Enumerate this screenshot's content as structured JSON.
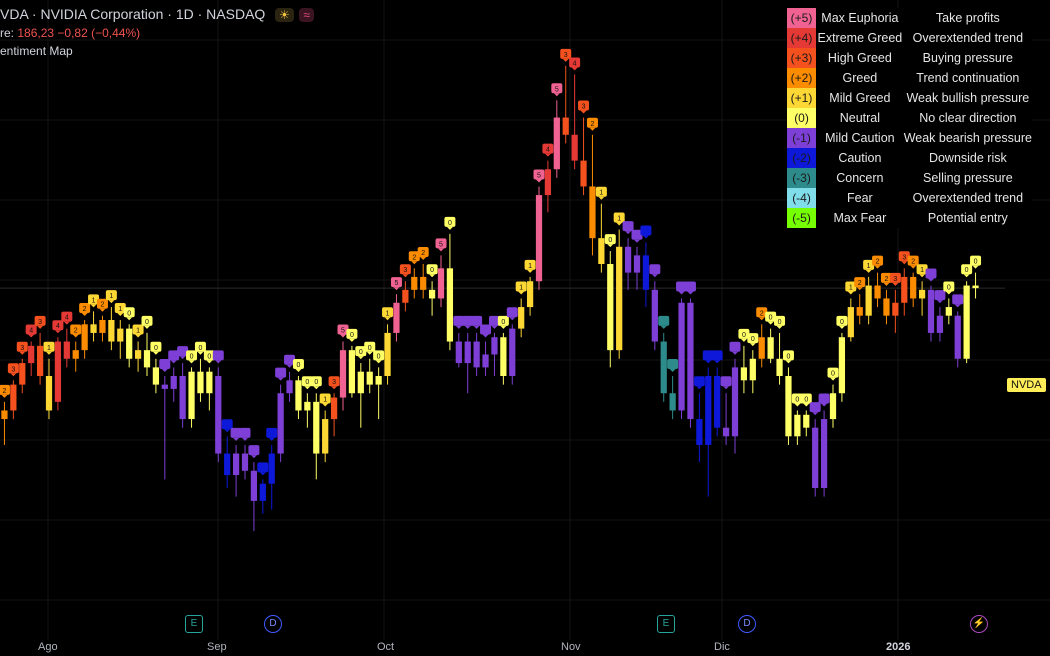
{
  "header": {
    "title": "VDA · NVIDIA Corporation · 1D · NASDAQ",
    "badge1": "☀",
    "badge2": "≈",
    "close_label": "re:",
    "close_value": "186,23",
    "change": "−0,82 (−0,44%)",
    "indicator": "entiment Map"
  },
  "legend": [
    {
      "code": "(+5)",
      "label": "Max Euphoria",
      "desc": "Take profits",
      "color": "#f06292"
    },
    {
      "code": "(+4)",
      "label": "Extreme Greed",
      "desc": "Overextended trend",
      "color": "#e53935"
    },
    {
      "code": "(+3)",
      "label": "High Greed",
      "desc": "Buying pressure",
      "color": "#f4511e"
    },
    {
      "code": "(+2)",
      "label": "Greed",
      "desc": "Trend continuation",
      "color": "#fb8c00"
    },
    {
      "code": "(+1)",
      "label": "Mild Greed",
      "desc": "Weak bullish pressure",
      "color": "#fdd835"
    },
    {
      "code": "(0)",
      "label": "Neutral",
      "desc": "No clear direction",
      "color": "#ffff66"
    },
    {
      "code": "(-1)",
      "label": "Mild Caution",
      "desc": "Weak bearish pressure",
      "color": "#7e3fd6"
    },
    {
      "code": "(-2)",
      "label": "Caution",
      "desc": "Downside risk",
      "color": "#0d18d8"
    },
    {
      "code": "(-3)",
      "label": "Concern",
      "desc": "Selling pressure",
      "color": "#2e8b8b"
    },
    {
      "code": "(-4)",
      "label": "Fear",
      "desc": "Overextended trend",
      "color": "#80deea"
    },
    {
      "code": "(-5)",
      "label": "Max Fear",
      "desc": "Potential entry",
      "color": "#76ff03"
    }
  ],
  "symbol_tag": "NVDA",
  "x_axis": {
    "labels": [
      "Ago",
      "Sep",
      "Oct",
      "Nov",
      "Dic",
      "2026"
    ],
    "bold": "2026"
  },
  "events": [
    {
      "type": "e",
      "glyph": "E"
    },
    {
      "type": "d",
      "glyph": "D"
    },
    {
      "type": "e",
      "glyph": "E"
    },
    {
      "type": "d",
      "glyph": "D"
    },
    {
      "type": "s",
      "glyph": "⚡"
    }
  ],
  "chart_data": {
    "type": "candlestick",
    "title": "NVIDIA Corporation · 1D · NASDAQ",
    "xlabel": "",
    "ylabel": "",
    "y_range_approx": [
      150,
      215
    ],
    "sentiment_scale": {
      "min": -5,
      "max": 5
    },
    "series": [
      {
        "name": "NVDA",
        "candles": [
          {
            "o": 171.0,
            "h": 173.0,
            "l": 168.0,
            "c": 172.0,
            "s": 2
          },
          {
            "o": 172.0,
            "h": 175.5,
            "l": 171.0,
            "c": 175.0,
            "s": 3
          },
          {
            "o": 175.0,
            "h": 178.0,
            "l": 174.0,
            "c": 177.5,
            "s": 3
          },
          {
            "o": 177.5,
            "h": 180.0,
            "l": 176.0,
            "c": 179.5,
            "s": 4
          },
          {
            "o": 179.5,
            "h": 181.0,
            "l": 175.0,
            "c": 176.0,
            "s": 3
          },
          {
            "o": 176.0,
            "h": 178.0,
            "l": 171.0,
            "c": 172.0,
            "s": 1
          },
          {
            "o": 173.0,
            "h": 180.5,
            "l": 172.0,
            "c": 180.0,
            "s": 4
          },
          {
            "o": 180.0,
            "h": 181.5,
            "l": 177.0,
            "c": 178.0,
            "s": 4
          },
          {
            "o": 178.0,
            "h": 180.0,
            "l": 176.5,
            "c": 179.0,
            "s": 2
          },
          {
            "o": 179.0,
            "h": 182.5,
            "l": 178.0,
            "c": 182.0,
            "s": 2
          },
          {
            "o": 182.0,
            "h": 183.5,
            "l": 180.0,
            "c": 181.0,
            "s": 1
          },
          {
            "o": 181.0,
            "h": 183.0,
            "l": 180.0,
            "c": 182.5,
            "s": 2
          },
          {
            "o": 182.5,
            "h": 184.0,
            "l": 179.0,
            "c": 180.0,
            "s": 1
          },
          {
            "o": 180.0,
            "h": 182.5,
            "l": 178.0,
            "c": 181.5,
            "s": 1
          },
          {
            "o": 181.5,
            "h": 182.0,
            "l": 177.0,
            "c": 178.0,
            "s": 0
          },
          {
            "o": 178.0,
            "h": 180.0,
            "l": 176.5,
            "c": 179.0,
            "s": 1
          },
          {
            "o": 179.0,
            "h": 181.0,
            "l": 176.0,
            "c": 177.0,
            "s": 0
          },
          {
            "o": 177.0,
            "h": 178.0,
            "l": 174.0,
            "c": 175.0,
            "s": 0
          },
          {
            "o": 175.0,
            "h": 176.0,
            "l": 164.0,
            "c": 174.5,
            "s": -1
          },
          {
            "o": 174.5,
            "h": 177.0,
            "l": 173.0,
            "c": 176.0,
            "s": -1
          },
          {
            "o": 176.0,
            "h": 177.5,
            "l": 170.0,
            "c": 171.0,
            "s": -1
          },
          {
            "o": 171.0,
            "h": 177.0,
            "l": 170.0,
            "c": 176.5,
            "s": 0
          },
          {
            "o": 176.5,
            "h": 178.0,
            "l": 173.0,
            "c": 174.0,
            "s": 0
          },
          {
            "o": 174.0,
            "h": 177.0,
            "l": 172.0,
            "c": 176.5,
            "s": 0
          },
          {
            "o": 176.0,
            "h": 177.0,
            "l": 166.0,
            "c": 167.0,
            "s": -1
          },
          {
            "o": 167.0,
            "h": 169.0,
            "l": 163.0,
            "c": 164.5,
            "s": -2
          },
          {
            "o": 164.5,
            "h": 168.0,
            "l": 162.0,
            "c": 167.0,
            "s": -1
          },
          {
            "o": 167.0,
            "h": 168.0,
            "l": 164.0,
            "c": 165.0,
            "s": -1
          },
          {
            "o": 165.0,
            "h": 166.0,
            "l": 158.0,
            "c": 161.5,
            "s": -1
          },
          {
            "o": 161.5,
            "h": 164.0,
            "l": 160.0,
            "c": 163.5,
            "s": -2
          },
          {
            "o": 163.5,
            "h": 168.0,
            "l": 160.5,
            "c": 167.0,
            "s": -2
          },
          {
            "o": 167.0,
            "h": 175.0,
            "l": 166.0,
            "c": 174.0,
            "s": -1
          },
          {
            "o": 174.0,
            "h": 176.5,
            "l": 173.0,
            "c": 175.5,
            "s": -1
          },
          {
            "o": 175.5,
            "h": 176.0,
            "l": 171.0,
            "c": 172.0,
            "s": 0
          },
          {
            "o": 172.0,
            "h": 174.0,
            "l": 170.0,
            "c": 173.0,
            "s": 0
          },
          {
            "o": 173.0,
            "h": 174.0,
            "l": 164.0,
            "c": 167.0,
            "s": 0
          },
          {
            "o": 167.0,
            "h": 172.0,
            "l": 166.0,
            "c": 171.0,
            "s": 1
          },
          {
            "o": 171.0,
            "h": 174.0,
            "l": 169.0,
            "c": 173.5,
            "s": 3
          },
          {
            "o": 173.5,
            "h": 180.0,
            "l": 172.0,
            "c": 179.0,
            "s": 5
          },
          {
            "o": 179.0,
            "h": 179.5,
            "l": 173.5,
            "c": 174.0,
            "s": 0
          },
          {
            "o": 174.0,
            "h": 177.5,
            "l": 170.0,
            "c": 176.5,
            "s": 0
          },
          {
            "o": 176.5,
            "h": 178.0,
            "l": 174.0,
            "c": 175.0,
            "s": 0
          },
          {
            "o": 175.0,
            "h": 177.0,
            "l": 171.0,
            "c": 176.0,
            "s": 0
          },
          {
            "o": 176.0,
            "h": 182.0,
            "l": 175.0,
            "c": 181.0,
            "s": 1
          },
          {
            "o": 181.0,
            "h": 185.5,
            "l": 180.0,
            "c": 184.5,
            "s": 5
          },
          {
            "o": 184.5,
            "h": 187.0,
            "l": 183.5,
            "c": 186.0,
            "s": 3
          },
          {
            "o": 186.0,
            "h": 188.5,
            "l": 185.0,
            "c": 187.5,
            "s": 2
          },
          {
            "o": 187.5,
            "h": 189.0,
            "l": 185.0,
            "c": 186.0,
            "s": 2
          },
          {
            "o": 186.0,
            "h": 187.0,
            "l": 183.0,
            "c": 185.0,
            "s": 0
          },
          {
            "o": 185.0,
            "h": 190.0,
            "l": 184.0,
            "c": 188.5,
            "s": 5
          },
          {
            "o": 188.5,
            "h": 192.5,
            "l": 179.0,
            "c": 180.0,
            "s": 0
          },
          {
            "o": 180.0,
            "h": 181.0,
            "l": 177.0,
            "c": 177.5,
            "s": -1
          },
          {
            "o": 177.5,
            "h": 181.0,
            "l": 174.0,
            "c": 180.0,
            "s": -1
          },
          {
            "o": 180.0,
            "h": 181.0,
            "l": 176.0,
            "c": 177.0,
            "s": -1
          },
          {
            "o": 177.0,
            "h": 180.0,
            "l": 176.0,
            "c": 178.5,
            "s": -1
          },
          {
            "o": 178.5,
            "h": 181.0,
            "l": 176.0,
            "c": 180.5,
            "s": -1
          },
          {
            "o": 180.5,
            "h": 181.0,
            "l": 175.0,
            "c": 176.0,
            "s": 0
          },
          {
            "o": 176.0,
            "h": 182.0,
            "l": 175.0,
            "c": 181.5,
            "s": -1
          },
          {
            "o": 181.5,
            "h": 185.0,
            "l": 180.5,
            "c": 184.0,
            "s": 1
          },
          {
            "o": 184.0,
            "h": 187.5,
            "l": 183.0,
            "c": 187.0,
            "s": 1
          },
          {
            "o": 187.0,
            "h": 198.0,
            "l": 186.0,
            "c": 197.0,
            "s": 5
          },
          {
            "o": 197.0,
            "h": 201.0,
            "l": 195.0,
            "c": 200.0,
            "s": 4
          },
          {
            "o": 200.0,
            "h": 208.0,
            "l": 199.0,
            "c": 206.0,
            "s": 5
          },
          {
            "o": 206.0,
            "h": 212.0,
            "l": 203.0,
            "c": 204.0,
            "s": 3
          },
          {
            "o": 204.0,
            "h": 211.0,
            "l": 200.0,
            "c": 201.0,
            "s": 4
          },
          {
            "o": 201.0,
            "h": 206.0,
            "l": 197.0,
            "c": 198.0,
            "s": 3
          },
          {
            "o": 198.0,
            "h": 204.0,
            "l": 190.0,
            "c": 192.0,
            "s": 2
          },
          {
            "o": 192.0,
            "h": 196.0,
            "l": 188.0,
            "c": 189.0,
            "s": 1
          },
          {
            "o": 189.0,
            "h": 190.5,
            "l": 177.0,
            "c": 179.0,
            "s": 0
          },
          {
            "o": 179.0,
            "h": 193.0,
            "l": 178.0,
            "c": 191.0,
            "s": 1
          },
          {
            "o": 191.0,
            "h": 192.0,
            "l": 186.0,
            "c": 188.0,
            "s": -1
          },
          {
            "o": 188.0,
            "h": 191.0,
            "l": 186.0,
            "c": 190.0,
            "s": -1
          },
          {
            "o": 190.0,
            "h": 191.5,
            "l": 184.0,
            "c": 186.0,
            "s": -2
          },
          {
            "o": 186.0,
            "h": 187.0,
            "l": 179.0,
            "c": 180.0,
            "s": -1
          },
          {
            "o": 180.0,
            "h": 181.0,
            "l": 173.0,
            "c": 174.0,
            "s": -3
          },
          {
            "o": 174.0,
            "h": 176.0,
            "l": 171.0,
            "c": 172.0,
            "s": -3
          },
          {
            "o": 172.0,
            "h": 185.0,
            "l": 171.0,
            "c": 184.5,
            "s": -1
          },
          {
            "o": 184.5,
            "h": 185.0,
            "l": 170.0,
            "c": 171.0,
            "s": -1
          },
          {
            "o": 171.0,
            "h": 174.0,
            "l": 166.0,
            "c": 168.0,
            "s": -2
          },
          {
            "o": 168.0,
            "h": 177.0,
            "l": 162.0,
            "c": 176.0,
            "s": -2
          },
          {
            "o": 176.0,
            "h": 177.0,
            "l": 169.0,
            "c": 170.0,
            "s": -2
          },
          {
            "o": 170.0,
            "h": 174.0,
            "l": 168.0,
            "c": 169.0,
            "s": -1
          },
          {
            "o": 169.0,
            "h": 178.0,
            "l": 167.0,
            "c": 177.0,
            "s": -1
          },
          {
            "o": 177.0,
            "h": 179.5,
            "l": 174.0,
            "c": 175.5,
            "s": 0
          },
          {
            "o": 175.5,
            "h": 179.0,
            "l": 174.0,
            "c": 178.0,
            "s": 0
          },
          {
            "o": 178.0,
            "h": 182.0,
            "l": 177.0,
            "c": 180.5,
            "s": 2
          },
          {
            "o": 180.5,
            "h": 181.5,
            "l": 177.5,
            "c": 178.0,
            "s": 0
          },
          {
            "o": 178.0,
            "h": 181.0,
            "l": 175.0,
            "c": 176.0,
            "s": 0
          },
          {
            "o": 176.0,
            "h": 177.0,
            "l": 168.0,
            "c": 169.0,
            "s": 0
          },
          {
            "o": 169.0,
            "h": 172.0,
            "l": 168.0,
            "c": 171.5,
            "s": 0
          },
          {
            "o": 171.5,
            "h": 172.0,
            "l": 169.0,
            "c": 170.0,
            "s": 0
          },
          {
            "o": 170.0,
            "h": 171.0,
            "l": 162.0,
            "c": 163.0,
            "s": -1
          },
          {
            "o": 163.0,
            "h": 172.0,
            "l": 162.0,
            "c": 171.0,
            "s": -1
          },
          {
            "o": 171.0,
            "h": 175.0,
            "l": 170.0,
            "c": 174.0,
            "s": 0
          },
          {
            "o": 174.0,
            "h": 181.0,
            "l": 173.0,
            "c": 180.5,
            "s": 0
          },
          {
            "o": 180.5,
            "h": 185.0,
            "l": 180.0,
            "c": 184.0,
            "s": 1
          },
          {
            "o": 184.0,
            "h": 185.5,
            "l": 182.0,
            "c": 183.0,
            "s": 2
          },
          {
            "o": 183.0,
            "h": 187.5,
            "l": 182.0,
            "c": 186.5,
            "s": 1
          },
          {
            "o": 186.5,
            "h": 188.0,
            "l": 184.0,
            "c": 185.0,
            "s": 2
          },
          {
            "o": 185.0,
            "h": 186.0,
            "l": 182.0,
            "c": 183.0,
            "s": 2
          },
          {
            "o": 183.0,
            "h": 186.0,
            "l": 181.0,
            "c": 184.5,
            "s": 3
          },
          {
            "o": 184.5,
            "h": 188.5,
            "l": 183.0,
            "c": 187.5,
            "s": 3
          },
          {
            "o": 187.5,
            "h": 188.0,
            "l": 184.0,
            "c": 185.0,
            "s": 2
          },
          {
            "o": 185.0,
            "h": 187.0,
            "l": 183.0,
            "c": 186.0,
            "s": 1
          },
          {
            "o": 186.0,
            "h": 186.5,
            "l": 180.0,
            "c": 181.0,
            "s": -1
          },
          {
            "o": 181.0,
            "h": 184.0,
            "l": 180.0,
            "c": 183.0,
            "s": -1
          },
          {
            "o": 183.0,
            "h": 185.0,
            "l": 182.0,
            "c": 184.0,
            "s": 0
          },
          {
            "o": 183.0,
            "h": 183.5,
            "l": 177.0,
            "c": 178.0,
            "s": -1
          },
          {
            "o": 178.0,
            "h": 187.0,
            "l": 177.5,
            "c": 186.5,
            "s": 0
          },
          {
            "o": 186.5,
            "h": 188.0,
            "l": 185.0,
            "c": 186.2,
            "s": 0
          }
        ]
      }
    ]
  }
}
